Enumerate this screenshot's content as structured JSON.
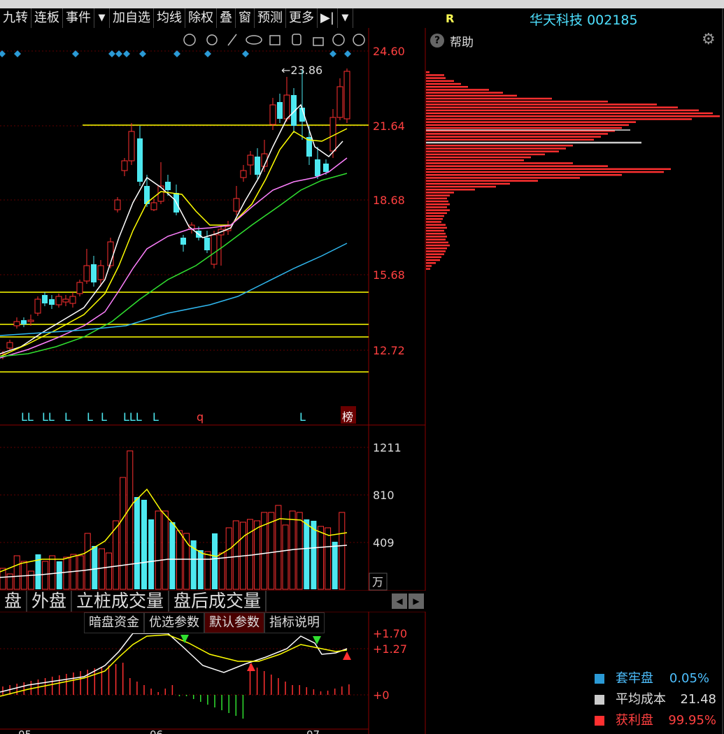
{
  "toolbar": {
    "items": [
      "九转",
      "连板",
      "事件",
      "▼",
      "加自选",
      "均线",
      "除权",
      "叠",
      "窗",
      "预测",
      "更多",
      "▶|",
      "▼"
    ]
  },
  "chart": {
    "peak_label": "←23.86",
    "price_axis": [
      "24.60",
      "21.64",
      "18.68",
      "15.68",
      "12.72"
    ],
    "volume_axis": [
      "1211",
      "810",
      "409"
    ],
    "volume_unit": "万",
    "macd_axis": [
      "+1.70",
      "+1.27",
      "+0"
    ],
    "signal_marks": [
      "LL",
      "LL",
      "L",
      "L",
      "L",
      "LLL",
      "L",
      "q",
      "L"
    ],
    "rank_badge": "榜",
    "date_ticks": [
      "05",
      "06",
      "07"
    ]
  },
  "tabs": [
    "盘",
    "外盘",
    "立桩成交量",
    "盘后成交量"
  ],
  "subtabs": [
    "暗盘资金",
    "优选参数",
    "默认参数",
    "指标说明"
  ],
  "right": {
    "code_label": "R",
    "stock_name": "华天科技",
    "stock_code": "002185",
    "help_label": "帮助",
    "legend": [
      {
        "label": "套牢盘",
        "value": "0.05%",
        "color": "#2b9ad6"
      },
      {
        "label": "平均成本",
        "value": "21.48",
        "color": "#cccccc"
      },
      {
        "label": "获利盘",
        "value": "99.95%",
        "color": "#ff3030"
      }
    ]
  },
  "colors": {
    "up": "#ff3030",
    "down": "#4de8f0",
    "ma5": "#ffffff",
    "ma10": "#ffff00",
    "ma20": "#ff80ff",
    "ma30": "#30e030",
    "ma60": "#30b8f0"
  }
}
